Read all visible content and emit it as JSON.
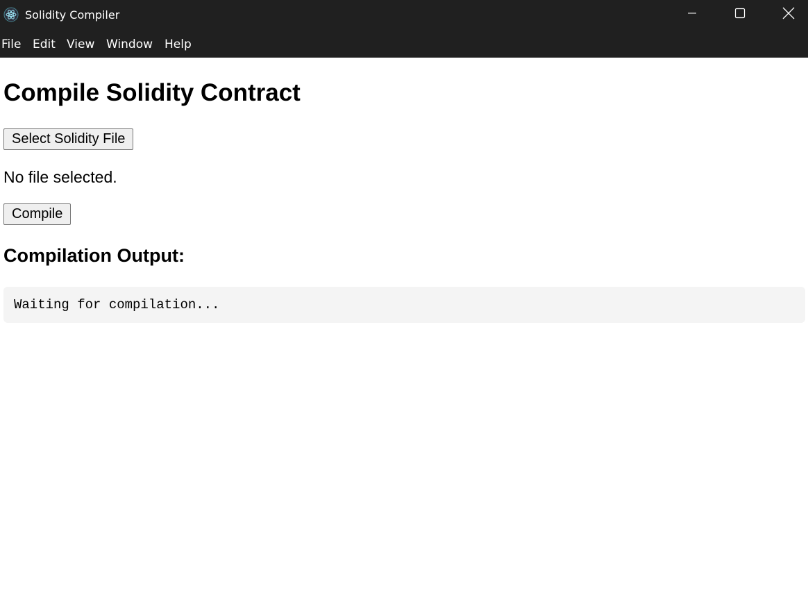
{
  "window": {
    "title": "Solidity Compiler",
    "icon": "electron-icon"
  },
  "menu": {
    "items": [
      "File",
      "Edit",
      "View",
      "Window",
      "Help"
    ]
  },
  "main": {
    "heading": "Compile Solidity Contract",
    "select_file_label": "Select Solidity File",
    "file_status": "No file selected.",
    "compile_label": "Compile",
    "output_heading": "Compilation Output:",
    "output_text": "Waiting for compilation..."
  },
  "colors": {
    "titlebar_bg": "#202020",
    "output_bg": "#f4f4f4",
    "button_bg": "#efefef"
  }
}
